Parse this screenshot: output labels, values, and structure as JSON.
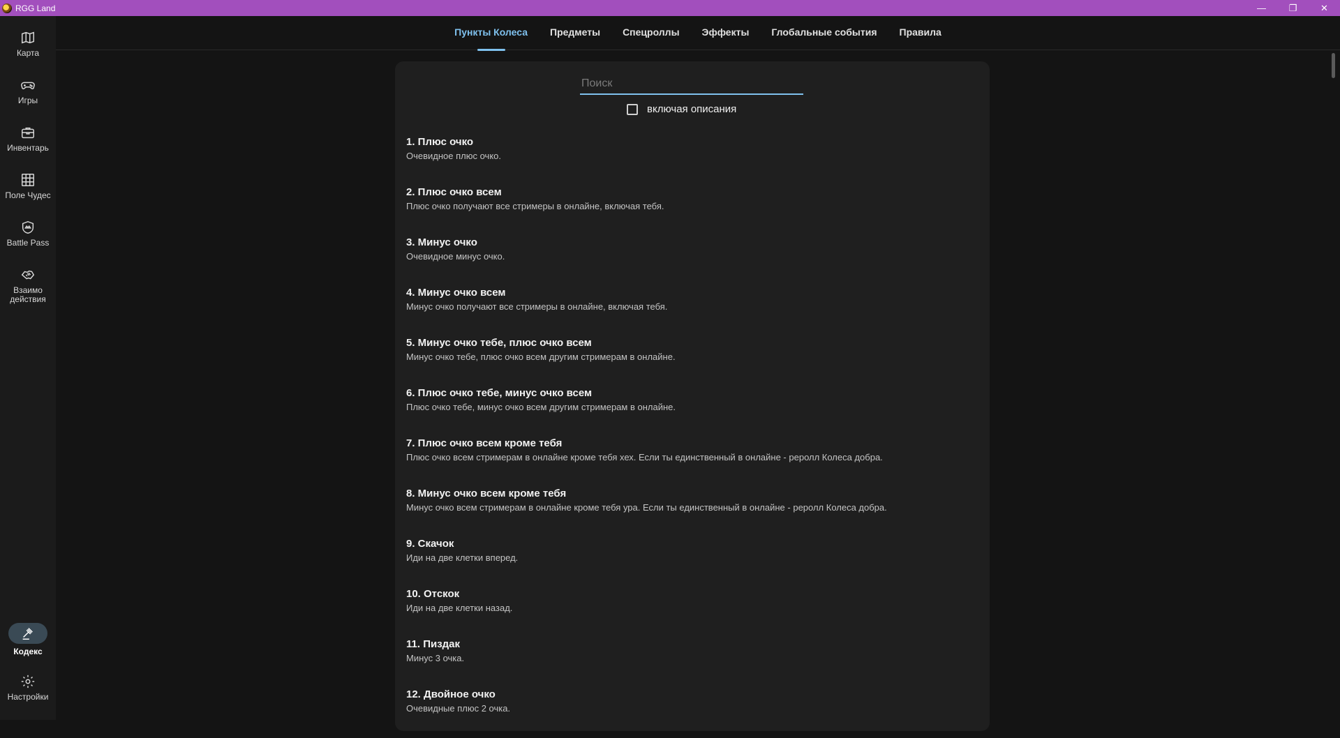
{
  "window": {
    "title": "RGG Land",
    "controls": [
      "—",
      "❐",
      "✕"
    ]
  },
  "sidebar": {
    "items": [
      {
        "label": "Карта",
        "icon": "map-icon"
      },
      {
        "label": "Игры",
        "icon": "gamepad-icon"
      },
      {
        "label": "Инвентарь",
        "icon": "briefcase-icon"
      },
      {
        "label": "Поле Чудес",
        "icon": "grid-icon"
      },
      {
        "label": "Battle Pass",
        "icon": "shield-icon"
      },
      {
        "label": "Взаимо действия",
        "icon": "handshake-icon"
      },
      {
        "label": "Кодекс",
        "icon": "gavel-icon",
        "active": true
      },
      {
        "label": "Настройки",
        "icon": "gear-icon"
      }
    ]
  },
  "tabs": [
    {
      "label": "Пункты Колеса",
      "active": true
    },
    {
      "label": "Предметы"
    },
    {
      "label": "Спецроллы"
    },
    {
      "label": "Эффекты"
    },
    {
      "label": "Глобальные события"
    },
    {
      "label": "Правила"
    }
  ],
  "search": {
    "placeholder": "Поиск",
    "value": ""
  },
  "filter": {
    "label": "включая описания",
    "checked": false
  },
  "items": [
    {
      "title": "1. Плюс очко",
      "desc": "Очевидное плюс очко."
    },
    {
      "title": "2. Плюс очко всем",
      "desc": "Плюс очко получают все стримеры в онлайне, включая тебя."
    },
    {
      "title": "3. Минус очко",
      "desc": "Очевидное минус очко."
    },
    {
      "title": "4. Минус очко всем",
      "desc": "Минус очко получают все стримеры в онлайне, включая тебя."
    },
    {
      "title": "5. Минус очко тебе, плюс очко всем",
      "desc": "Минус очко тебе, плюс очко всем другим стримерам в онлайне."
    },
    {
      "title": "6. Плюс очко тебе, минус очко всем",
      "desc": "Плюс очко тебе, минус очко всем другим стримерам в онлайне."
    },
    {
      "title": "7. Плюс очко всем кроме тебя",
      "desc": "Плюс очко всем стримерам в онлайне кроме тебя хех. Если ты единственный в онлайне - реролл Колеса добра."
    },
    {
      "title": "8. Минус очко всем кроме тебя",
      "desc": "Минус очко всем стримерам в онлайне кроме тебя ура. Если ты единственный в онлайне - реролл Колеса добра."
    },
    {
      "title": "9. Скачок",
      "desc": "Иди на две клетки вперед."
    },
    {
      "title": "10. Отскок",
      "desc": "Иди на две клетки назад."
    },
    {
      "title": "11. Пиздак",
      "desc": "Минус 3 очка."
    },
    {
      "title": "12. Двойное очко",
      "desc": "Очевидные плюс 2 очка."
    }
  ]
}
